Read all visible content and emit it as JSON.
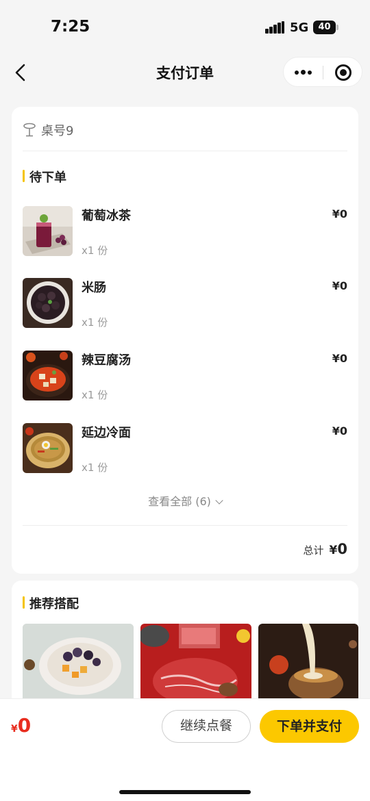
{
  "status_bar": {
    "time": "7:25",
    "network": "5G",
    "battery": "40"
  },
  "nav": {
    "title": "支付订单"
  },
  "table": {
    "label": "桌号9"
  },
  "pending": {
    "title": "待下单",
    "items": [
      {
        "name": "葡萄冰茶",
        "qty": "x1 份",
        "price": "¥0"
      },
      {
        "name": "米肠",
        "qty": "x1 份",
        "price": "¥0"
      },
      {
        "name": "辣豆腐汤",
        "qty": "x1 份",
        "price": "¥0"
      },
      {
        "name": "延边冷面",
        "qty": "x1 份",
        "price": "¥0"
      }
    ],
    "view_all": "查看全部 (6)",
    "total_label": "总计",
    "total_currency": "¥",
    "total_value": "0"
  },
  "recommend": {
    "title": "推荐搭配"
  },
  "bottom": {
    "currency": "¥",
    "amount": "0",
    "continue_label": "继续点餐",
    "pay_label": "下单并支付"
  },
  "colors": {
    "accent": "#fcc800",
    "price_red": "#e82c1e"
  }
}
